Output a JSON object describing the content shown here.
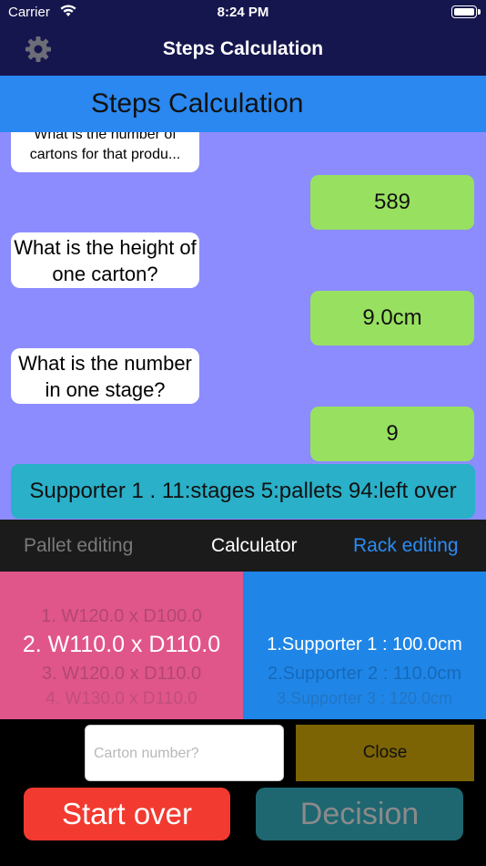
{
  "status_bar": {
    "carrier": "Carrier",
    "time": "8:24 PM"
  },
  "navbar": {
    "title": "Steps Calculation",
    "settings_icon": "gear-icon"
  },
  "header": {
    "title": "Steps Calculation"
  },
  "conversation": {
    "q1": "What is the number of cartons for that produ...",
    "a1": "589",
    "q2": "What is the height of one carton?",
    "a2": "9.0cm",
    "q3": "What is the number in one stage?",
    "a3": "9",
    "result": "Supporter  1 . 11:stages 5:pallets 94:left over"
  },
  "tabs": {
    "pallet": "Pallet editing",
    "calculator": "Calculator",
    "rack": "Rack editing"
  },
  "pallet_picker": {
    "options": [
      "1. W120.0 x D100.0",
      "2. W110.0 x D110.0",
      "3. W120.0 x D110.0",
      "4. W130.0 x D110.0"
    ],
    "selected": "2. W110.0 x D110.0"
  },
  "supporter_picker": {
    "options": [
      "1.Supporter  1 : 100.0cm",
      "2.Supporter 2 : 110.0cm",
      "3.Supporter 3 : 120.0cm"
    ],
    "selected": "1.Supporter  1 : 100.0cm"
  },
  "controls": {
    "carton_placeholder": "Carton number?",
    "close": "Close",
    "start_over": "Start over",
    "decision": "Decision"
  },
  "colors": {
    "navbar": "#16164e",
    "header": "#2a88f0",
    "content_bg": "#8c8cff",
    "answer_bubble": "#98e060",
    "result_bubble": "#2ab0c8",
    "pallet_picker": "#e0568a",
    "supporter_picker": "#1f86e8",
    "close_button": "#7c6404",
    "start_over_button": "#f23a30",
    "decision_button": "#1e6670"
  }
}
